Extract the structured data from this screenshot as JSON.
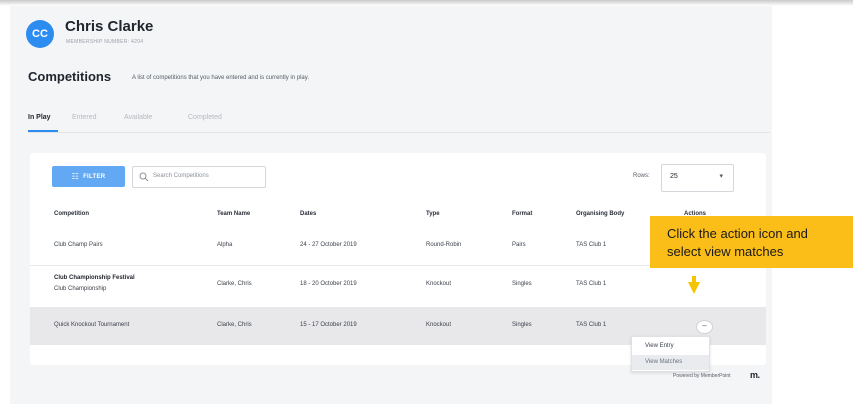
{
  "user": {
    "initials": "CC",
    "name": "Chris Clarke",
    "membership": "MEMBERSHIP NUMBER: 4204"
  },
  "section": {
    "title": "Competitions",
    "description": "A list of competitions that you have entered and is currently in play."
  },
  "tabs": [
    "In Play",
    "Entered",
    "Available",
    "Completed"
  ],
  "toolbar": {
    "filter_label": "FILTER",
    "search_placeholder": "Search Competitions",
    "rows_label": "Rows:",
    "rows_value": "25"
  },
  "table": {
    "headers": [
      "Competition",
      "Team Name",
      "Dates",
      "Type",
      "Format",
      "Organising Body",
      "Actions"
    ],
    "rows": [
      {
        "competition": "Club Champ Pairs",
        "subtitle": "",
        "team": "Alpha",
        "dates": "24 - 27 October 2019",
        "type": "Round-Robin",
        "format": "Pairs",
        "body": "TAS Club 1"
      },
      {
        "competition": "Club Championship Festival",
        "subtitle": "Club Championship",
        "team": "Clarke, Chris",
        "dates": "18 - 20 October 2019",
        "type": "Knockout",
        "format": "Singles",
        "body": "TAS Club 1"
      },
      {
        "competition": "Quick Knockout Tournament",
        "subtitle": "",
        "team": "Clarke, Chris",
        "dates": "15 - 17 October 2019",
        "type": "Knockout",
        "format": "Singles",
        "body": "TAS Club 1"
      }
    ]
  },
  "actions_menu": [
    "View Entry",
    "View Matches"
  ],
  "callout": {
    "line1": "Click the action icon and",
    "line2": "select view matches"
  },
  "footer": {
    "powered": "Powered by MemberPoint",
    "logo": "m."
  },
  "colors": {
    "accent": "#2d8cf0",
    "filter_button": "#63a8f2",
    "callout": "#fbbd18"
  }
}
